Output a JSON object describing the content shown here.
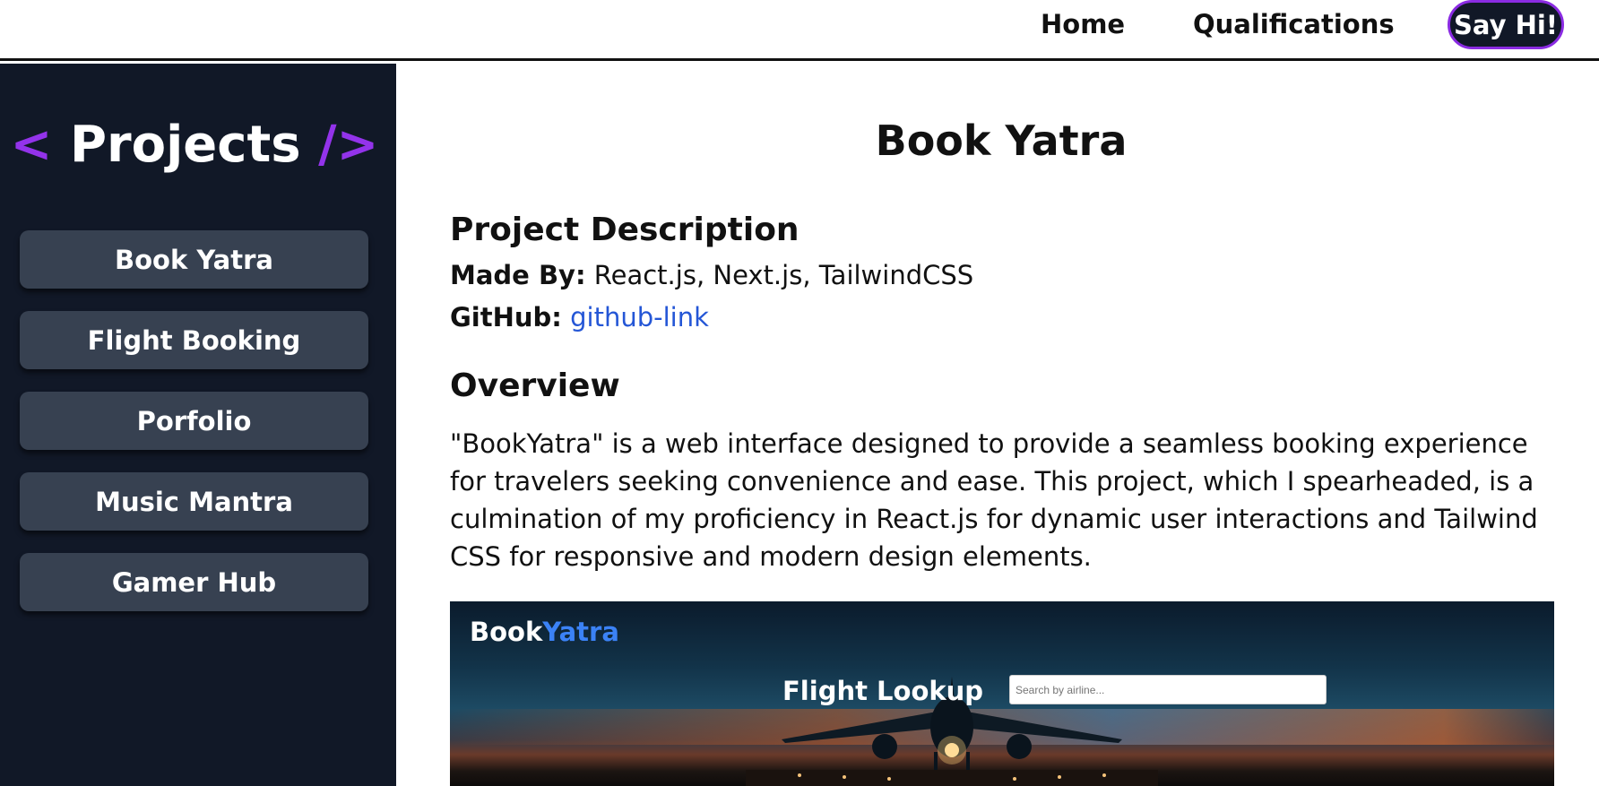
{
  "nav": {
    "links": [
      "Home",
      "Qualifications"
    ],
    "cta": "Say Hi!"
  },
  "sidebar": {
    "title_open": "<",
    "title_text": "Projects",
    "title_close": "/>",
    "projects": [
      "Book Yatra",
      "Flight Booking",
      "Porfolio",
      "Music Mantra",
      "Gamer Hub"
    ]
  },
  "main": {
    "title": "Book Yatra",
    "description_heading": "Project Description",
    "made_by_label": "Made By:",
    "made_by_value": "React.js, Next.js, TailwindCSS",
    "github_label": "GitHub:",
    "github_link_text": "github-link",
    "overview_heading": "Overview",
    "overview_text": "\"BookYatra\" is a web interface designed to provide a seamless booking experience for travelers seeking convenience and ease. This project, which I spearheaded, is a culmination of my proficiency in React.js for dynamic user interactions and Tailwind CSS for responsive and modern design elements."
  },
  "banner": {
    "brand_part1": "Book",
    "brand_part2": "Yatra",
    "title": "Flight Lookup",
    "search_placeholder": "Search by airline..."
  },
  "colors": {
    "accent_purple": "#9333ea",
    "sidebar_bg": "#111827",
    "button_bg": "#374151",
    "link_blue": "#2456d6",
    "brand_blue": "#3b82f6"
  }
}
